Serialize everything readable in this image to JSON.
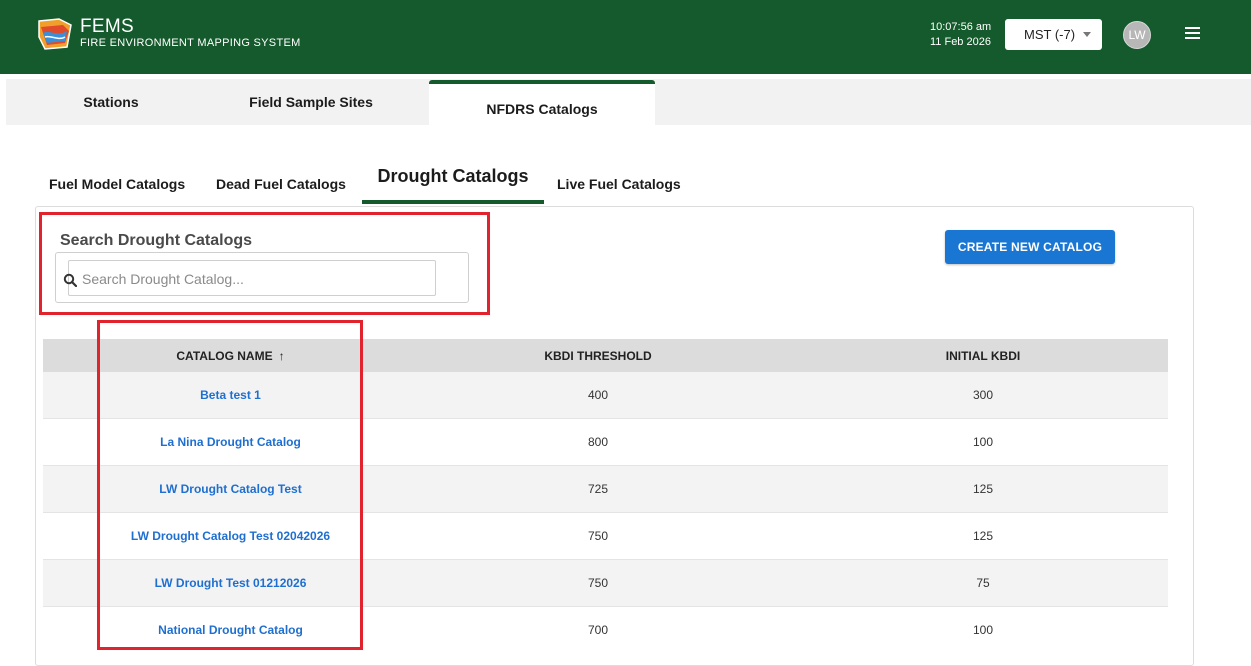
{
  "header": {
    "title": "FEMS",
    "subtitle": "FIRE ENVIRONMENT MAPPING SYSTEM",
    "time": "10:07:56 am",
    "date": "11 Feb 2026",
    "timezone": "MST (-7)",
    "avatar_initials": "LW",
    "brand_color": "#155a2c"
  },
  "top_tabs": [
    {
      "label": "Stations"
    },
    {
      "label": "Field Sample Sites"
    },
    {
      "label": "NFDRS Catalogs",
      "active": true
    }
  ],
  "sub_tabs": [
    {
      "label": "Fuel Model Catalogs"
    },
    {
      "label": "Dead Fuel Catalogs"
    },
    {
      "label": "Drought Catalogs",
      "active": true
    },
    {
      "label": "Live Fuel Catalogs"
    }
  ],
  "search": {
    "label": "Search Drought Catalogs",
    "placeholder": "Search Drought Catalog...",
    "value": ""
  },
  "create_button": {
    "label": "CREATE NEW CATALOG",
    "color": "#1976d2"
  },
  "table": {
    "columns": [
      "CATALOG NAME",
      "KBDI THRESHOLD",
      "INITIAL KBDI"
    ],
    "sort_indicator": "↑",
    "rows": [
      {
        "name": "Beta test 1",
        "kbdi_threshold": "400",
        "initial_kbdi": "300"
      },
      {
        "name": "La Nina Drought Catalog",
        "kbdi_threshold": "800",
        "initial_kbdi": "100"
      },
      {
        "name": "LW Drought Catalog Test",
        "kbdi_threshold": "725",
        "initial_kbdi": "125"
      },
      {
        "name": "LW Drought Catalog Test 02042026",
        "kbdi_threshold": "750",
        "initial_kbdi": "125"
      },
      {
        "name": "LW Drought Test 01212026",
        "kbdi_threshold": "750",
        "initial_kbdi": "75"
      },
      {
        "name": "National Drought Catalog",
        "kbdi_threshold": "700",
        "initial_kbdi": "100"
      }
    ]
  },
  "annotation_color": "#e0232c"
}
